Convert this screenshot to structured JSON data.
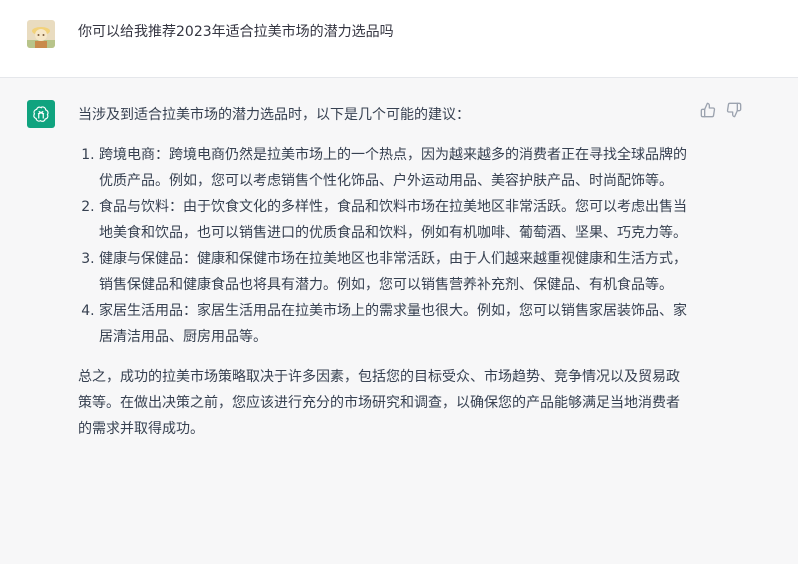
{
  "conversation": {
    "user_message": "你可以给我推荐2023年适合拉美市场的潜力选品吗",
    "assistant": {
      "intro": "当涉及到适合拉美市场的潜力选品时，以下是几个可能的建议：",
      "items": [
        "跨境电商：跨境电商仍然是拉美市场上的一个热点，因为越来越多的消费者正在寻找全球品牌的优质产品。例如，您可以考虑销售个性化饰品、户外运动用品、美容护肤产品、时尚配饰等。",
        "食品与饮料：由于饮食文化的多样性，食品和饮料市场在拉美地区非常活跃。您可以考虑出售当地美食和饮品，也可以销售进口的优质食品和饮料，例如有机咖啡、葡萄酒、坚果、巧克力等。",
        "健康与保健品：健康和保健市场在拉美地区也非常活跃，由于人们越来越重视健康和生活方式，销售保健品和健康食品也将具有潜力。例如，您可以销售营养补充剂、保健品、有机食品等。",
        "家居生活用品：家居生活用品在拉美市场上的需求量也很大。例如，您可以销售家居装饰品、家居清洁用品、厨房用品等。"
      ],
      "summary": "总之，成功的拉美市场策略取决于许多因素，包括您的目标受众、市场趋势、竞争情况以及贸易政策等。在做出决策之前，您应该进行充分的市场研究和调查，以确保您的产品能够满足当地消费者的需求并取得成功。"
    }
  },
  "icons": {
    "user_avatar": "user-avatar-icon",
    "assistant_avatar": "openai-logo-icon",
    "thumbs_up": "thumbs-up-icon",
    "thumbs_down": "thumbs-down-icon"
  },
  "colors": {
    "assistant_avatar_bg": "#10a37f",
    "assistant_row_bg": "#f7f7f8",
    "text": "#374151"
  }
}
